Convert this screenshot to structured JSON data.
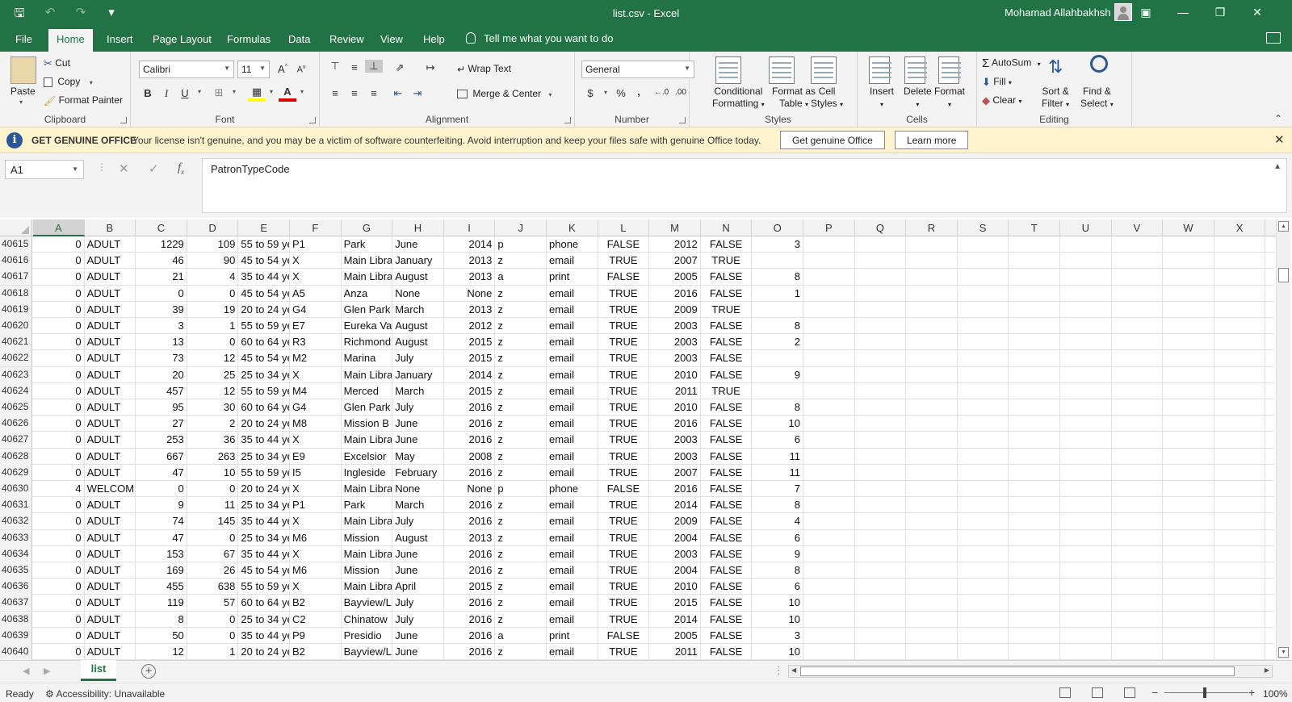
{
  "window": {
    "title": "list.csv  -  Excel",
    "user": "Mohamad Allahbakhsh"
  },
  "tabs": [
    {
      "label": "File"
    },
    {
      "label": "Home"
    },
    {
      "label": "Insert"
    },
    {
      "label": "Page Layout"
    },
    {
      "label": "Formulas"
    },
    {
      "label": "Data"
    },
    {
      "label": "Review"
    },
    {
      "label": "View"
    },
    {
      "label": "Help"
    }
  ],
  "tell_me": "Tell me what you want to do",
  "ribbon": {
    "clipboard": {
      "label": "Clipboard",
      "paste": "Paste",
      "cut": "Cut",
      "copy": "Copy",
      "format_painter": "Format Painter"
    },
    "font": {
      "label": "Font",
      "name": "Calibri",
      "size": "11",
      "bold": "B",
      "italic": "I",
      "underline": "U"
    },
    "alignment": {
      "label": "Alignment",
      "wrap": "Wrap Text",
      "merge": "Merge & Center"
    },
    "number": {
      "label": "Number",
      "format": "General",
      "currency": "$",
      "percent": "%",
      "comma": ","
    },
    "styles": {
      "label": "Styles",
      "conditional": "Conditional",
      "conditional2": "Formatting",
      "format_table": "Format as",
      "format_table2": "Table",
      "cell_styles": "Cell",
      "cell_styles2": "Styles"
    },
    "cells": {
      "label": "Cells",
      "insert": "Insert",
      "delete": "Delete",
      "format": "Format"
    },
    "editing": {
      "label": "Editing",
      "autosum": "AutoSum",
      "fill": "Fill",
      "clear": "Clear",
      "sort": "Sort &",
      "sort2": "Filter",
      "find": "Find &",
      "find2": "Select"
    }
  },
  "notice": {
    "title": "GET GENUINE OFFICE",
    "message": "Your license isn't genuine, and you may be a victim of software counterfeiting. Avoid interruption and keep your files safe with genuine Office today.",
    "btn_genuine": "Get genuine Office",
    "btn_learn": "Learn more"
  },
  "formula_bar": {
    "name_box": "A1",
    "formula": "PatronTypeCode"
  },
  "columns": [
    "A",
    "B",
    "C",
    "D",
    "E",
    "F",
    "G",
    "H",
    "I",
    "J",
    "K",
    "L",
    "M",
    "N",
    "O",
    "P",
    "Q",
    "R",
    "S",
    "T",
    "U",
    "V",
    "W",
    "X"
  ],
  "rows": [
    [
      "40615",
      "0",
      "ADULT",
      "1229",
      "109",
      "55 to 59 ye",
      "P1",
      "Park",
      "June",
      "2014",
      "p",
      "phone",
      "FALSE",
      "2012",
      "FALSE",
      "3"
    ],
    [
      "40616",
      "0",
      "ADULT",
      "46",
      "90",
      "45 to 54 ye",
      "X",
      "Main Libra",
      "January",
      "2013",
      "z",
      "email",
      "TRUE",
      "2007",
      "TRUE",
      ""
    ],
    [
      "40617",
      "0",
      "ADULT",
      "21",
      "4",
      "35 to 44 ye",
      "X",
      "Main Libra",
      "August",
      "2013",
      "a",
      "print",
      "FALSE",
      "2005",
      "FALSE",
      "8"
    ],
    [
      "40618",
      "0",
      "ADULT",
      "0",
      "0",
      "45 to 54 ye",
      "A5",
      "Anza",
      "None",
      "None",
      "z",
      "email",
      "TRUE",
      "2016",
      "FALSE",
      "1"
    ],
    [
      "40619",
      "0",
      "ADULT",
      "39",
      "19",
      "20 to 24 ye",
      "G4",
      "Glen Park",
      "March",
      "2013",
      "z",
      "email",
      "TRUE",
      "2009",
      "TRUE",
      ""
    ],
    [
      "40620",
      "0",
      "ADULT",
      "3",
      "1",
      "55 to 59 ye",
      "E7",
      "Eureka Va",
      "August",
      "2012",
      "z",
      "email",
      "TRUE",
      "2003",
      "FALSE",
      "8"
    ],
    [
      "40621",
      "0",
      "ADULT",
      "13",
      "0",
      "60 to 64 ye",
      "R3",
      "Richmond",
      "August",
      "2015",
      "z",
      "email",
      "TRUE",
      "2003",
      "FALSE",
      "2"
    ],
    [
      "40622",
      "0",
      "ADULT",
      "73",
      "12",
      "45 to 54 ye",
      "M2",
      "Marina",
      "July",
      "2015",
      "z",
      "email",
      "TRUE",
      "2003",
      "FALSE",
      ""
    ],
    [
      "40623",
      "0",
      "ADULT",
      "20",
      "25",
      "25 to 34 ye",
      "X",
      "Main Libra",
      "January",
      "2014",
      "z",
      "email",
      "TRUE",
      "2010",
      "FALSE",
      "9"
    ],
    [
      "40624",
      "0",
      "ADULT",
      "457",
      "12",
      "55 to 59 ye",
      "M4",
      "Merced",
      "March",
      "2015",
      "z",
      "email",
      "TRUE",
      "2011",
      "TRUE",
      ""
    ],
    [
      "40625",
      "0",
      "ADULT",
      "95",
      "30",
      "60 to 64 ye",
      "G4",
      "Glen Park",
      "July",
      "2016",
      "z",
      "email",
      "TRUE",
      "2010",
      "FALSE",
      "8"
    ],
    [
      "40626",
      "0",
      "ADULT",
      "27",
      "2",
      "20 to 24 ye",
      "M8",
      "Mission B",
      "June",
      "2016",
      "z",
      "email",
      "TRUE",
      "2016",
      "FALSE",
      "10"
    ],
    [
      "40627",
      "0",
      "ADULT",
      "253",
      "36",
      "35 to 44 ye",
      "X",
      "Main Libra",
      "June",
      "2016",
      "z",
      "email",
      "TRUE",
      "2003",
      "FALSE",
      "6"
    ],
    [
      "40628",
      "0",
      "ADULT",
      "667",
      "263",
      "25 to 34 ye",
      "E9",
      "Excelsior",
      "May",
      "2008",
      "z",
      "email",
      "TRUE",
      "2003",
      "FALSE",
      "11"
    ],
    [
      "40629",
      "0",
      "ADULT",
      "47",
      "10",
      "55 to 59 ye",
      "I5",
      "Ingleside",
      "February",
      "2016",
      "z",
      "email",
      "TRUE",
      "2007",
      "FALSE",
      "11"
    ],
    [
      "40630",
      "4",
      "WELCOME",
      "0",
      "0",
      "20 to 24 ye",
      "X",
      "Main Libra",
      "None",
      "None",
      "p",
      "phone",
      "FALSE",
      "2016",
      "FALSE",
      "7"
    ],
    [
      "40631",
      "0",
      "ADULT",
      "9",
      "11",
      "25 to 34 ye",
      "P1",
      "Park",
      "March",
      "2016",
      "z",
      "email",
      "TRUE",
      "2014",
      "FALSE",
      "8"
    ],
    [
      "40632",
      "0",
      "ADULT",
      "74",
      "145",
      "35 to 44 ye",
      "X",
      "Main Libra",
      "July",
      "2016",
      "z",
      "email",
      "TRUE",
      "2009",
      "FALSE",
      "4"
    ],
    [
      "40633",
      "0",
      "ADULT",
      "47",
      "0",
      "25 to 34 ye",
      "M6",
      "Mission",
      "August",
      "2013",
      "z",
      "email",
      "TRUE",
      "2004",
      "FALSE",
      "6"
    ],
    [
      "40634",
      "0",
      "ADULT",
      "153",
      "67",
      "35 to 44 ye",
      "X",
      "Main Libra",
      "June",
      "2016",
      "z",
      "email",
      "TRUE",
      "2003",
      "FALSE",
      "9"
    ],
    [
      "40635",
      "0",
      "ADULT",
      "169",
      "26",
      "45 to 54 ye",
      "M6",
      "Mission",
      "June",
      "2016",
      "z",
      "email",
      "TRUE",
      "2004",
      "FALSE",
      "8"
    ],
    [
      "40636",
      "0",
      "ADULT",
      "455",
      "638",
      "55 to 59 ye",
      "X",
      "Main Libra",
      "April",
      "2015",
      "z",
      "email",
      "TRUE",
      "2010",
      "FALSE",
      "6"
    ],
    [
      "40637",
      "0",
      "ADULT",
      "119",
      "57",
      "60 to 64 ye",
      "B2",
      "Bayview/L",
      "July",
      "2016",
      "z",
      "email",
      "TRUE",
      "2015",
      "FALSE",
      "10"
    ],
    [
      "40638",
      "0",
      "ADULT",
      "8",
      "0",
      "25 to 34 ye",
      "C2",
      "Chinatow",
      "July",
      "2016",
      "z",
      "email",
      "TRUE",
      "2014",
      "FALSE",
      "10"
    ],
    [
      "40639",
      "0",
      "ADULT",
      "50",
      "0",
      "35 to 44 ye",
      "P9",
      "Presidio",
      "June",
      "2016",
      "a",
      "print",
      "FALSE",
      "2005",
      "FALSE",
      "3"
    ],
    [
      "40640",
      "0",
      "ADULT",
      "12",
      "1",
      "20 to 24 ye",
      "B2",
      "Bayview/L",
      "June",
      "2016",
      "z",
      "email",
      "TRUE",
      "2011",
      "FALSE",
      "10"
    ]
  ],
  "sheet": {
    "name": "list",
    "add": "+"
  },
  "status": {
    "ready": "Ready",
    "accessibility": "Accessibility: Unavailable",
    "zoom": "100%"
  }
}
